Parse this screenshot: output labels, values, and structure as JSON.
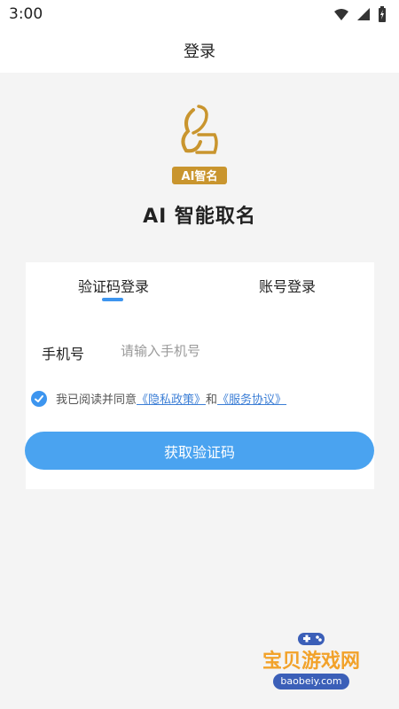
{
  "status_bar": {
    "time": "3:00"
  },
  "header": {
    "title": "登录"
  },
  "logo": {
    "badge_text": "AI智名"
  },
  "app": {
    "name": "AI 智能取名"
  },
  "tabs": [
    {
      "label": "验证码登录",
      "active": true
    },
    {
      "label": "账号登录",
      "active": false
    }
  ],
  "form": {
    "phone_label": "手机号",
    "phone_placeholder": "请输入手机号",
    "phone_value": ""
  },
  "agreement": {
    "checked": true,
    "prefix": "我已阅读并同意",
    "privacy_link": "《隐私政策》",
    "conjunction": "和",
    "service_link": "《服务协议》"
  },
  "actions": {
    "get_code_label": "获取验证码"
  },
  "watermark": {
    "title": "宝贝游戏网",
    "url": "baobeiy.com"
  },
  "colors": {
    "accent": "#3d95ef",
    "button": "#4aa3f0",
    "link": "#3d7fd6",
    "logo_gold": "#c9952e"
  }
}
